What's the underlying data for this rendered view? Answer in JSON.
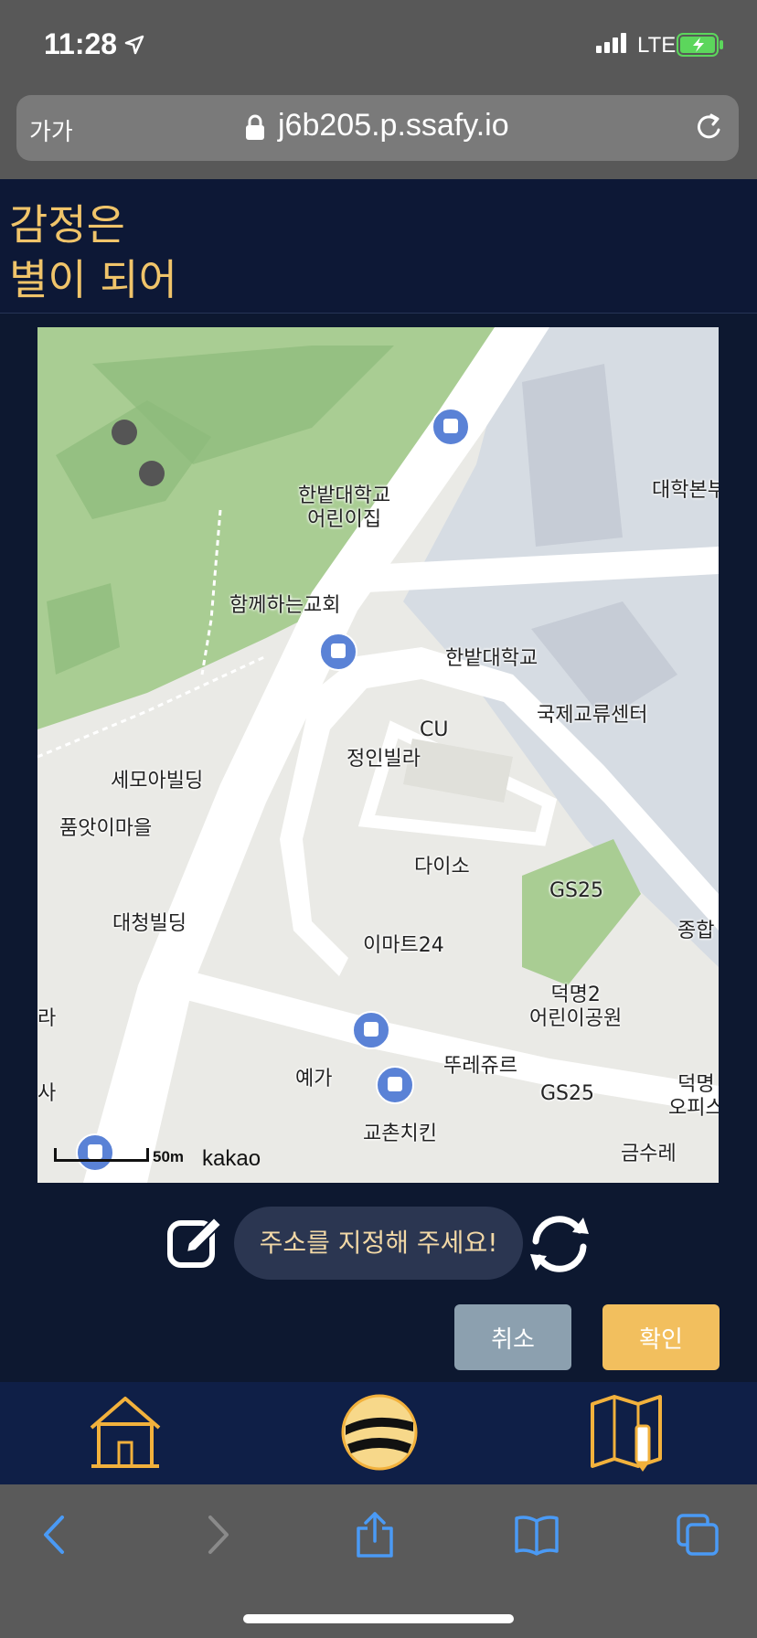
{
  "status": {
    "time": "11:28",
    "network": "LTE"
  },
  "browser": {
    "text_size_label": "가가",
    "url": "j6b205.p.ssafy.io"
  },
  "app": {
    "title_line1": "감정은",
    "title_line2": "별이 되어"
  },
  "map": {
    "labels": {
      "kindergarten": "한밭대학교\n어린이집",
      "church": "함께하는교회",
      "university": "한밭대학교",
      "admin": "대학본부",
      "intl_center": "국제교류센터",
      "cu": "CU",
      "villa": "정인빌라",
      "semo": "세모아빌딩",
      "poomat": "품앗이마을",
      "daiso": "다이소",
      "gs25_a": "GS25",
      "daecheong": "대청빌딩",
      "emart": "이마트24",
      "sogo": "종합",
      "park": "덕명2\n어린이공원",
      "ra": "라",
      "sa": "사",
      "yega": "예가",
      "tous": "뚜레쥬르",
      "gs25_b": "GS25",
      "deokmyeong": "덕명\n오피스",
      "kyochon": "교촌치킨",
      "geumsure": "금수레"
    },
    "scale_label": "50m",
    "attribution": "kakao"
  },
  "address": {
    "placeholder_text": "주소를 지정해 주세요!"
  },
  "buttons": {
    "cancel": "취소",
    "confirm": "확인"
  },
  "colors": {
    "accent": "#f2bf5e",
    "header_bg": "#0d1836",
    "cancel_bg": "#8ca0af"
  }
}
